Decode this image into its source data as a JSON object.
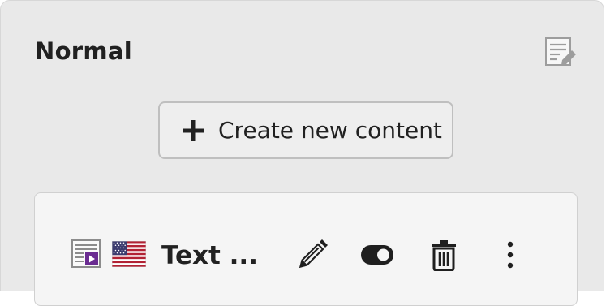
{
  "column": {
    "title": "Normal",
    "edit_icon": "edit-column-icon"
  },
  "create_button": {
    "label": "Create new content",
    "icon": "plus-icon"
  },
  "record": {
    "title": "Text ...",
    "content_type_icon": "text-media-content-icon",
    "language_flag_icon": "us-flag-icon",
    "actions": {
      "edit_icon": "pencil-icon",
      "toggle_icon": "toggle-on-icon",
      "delete_icon": "trash-icon",
      "more_icon": "more-vertical-icon"
    }
  },
  "colors": {
    "column_background": "#e9e9e9",
    "card_background": "#f5f5f5",
    "text": "#212121",
    "content_type_accent": "#6a2c91",
    "flag_red": "#b22234",
    "flag_blue": "#3c3b6e"
  }
}
